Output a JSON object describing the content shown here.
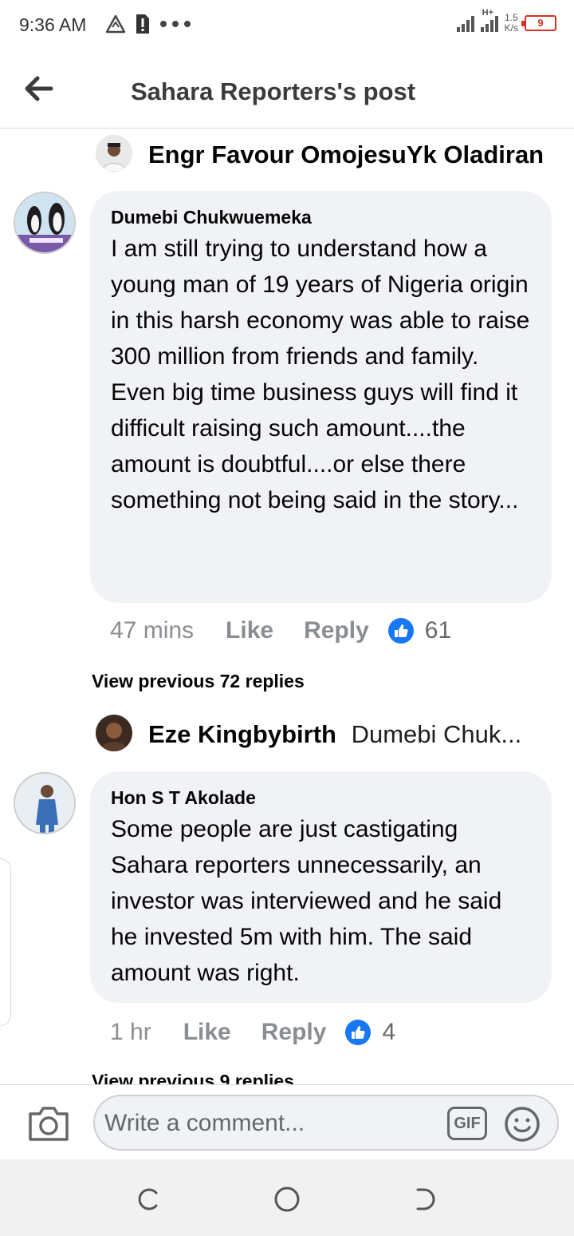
{
  "status_bar": {
    "time": "9:36 AM",
    "network_label": "H+",
    "net_speed_value": "1.5",
    "net_speed_unit": "K/s",
    "battery": "9"
  },
  "header": {
    "title": "Sahara Reporters's post"
  },
  "comments": [
    {
      "reply_preview": {
        "author": "Engr Favour OmojesuYk Oladiran",
        "snippet": ""
      },
      "author": "Dumebi Chukwuemeka",
      "text": "I am still trying to understand  how a young man of 19 years of Nigeria origin in this harsh economy was able to raise 300 million from friends and family. Even big time business guys will find it difficult raising such amount....the amount is doubtful....or else there something not being said in the story...",
      "time": "47 mins",
      "like_label": "Like",
      "reply_label": "Reply",
      "reactions": "61",
      "view_previous": "View previous 72 replies"
    },
    {
      "reply_preview": {
        "author": "Eze Kingbybirth",
        "snippet": "Dumebi Chuk..."
      },
      "author": "Hon S T Akolade",
      "text": "Some people are just castigating Sahara reporters unnecessarily, an investor was interviewed and he said he invested 5m with him. The said amount was right.",
      "time": "1 hr",
      "like_label": "Like",
      "reply_label": "Reply",
      "reactions": "4",
      "view_previous": "View previous 9 replies"
    }
  ],
  "composer": {
    "placeholder": "Write a comment...",
    "gif_label": "GIF"
  },
  "colors": {
    "accent": "#1877f2",
    "bubble": "#f0f2f5",
    "muted": "#8a8d91",
    "battery_low": "#d93025"
  },
  "icons": [
    "back-arrow-icon",
    "camera-icon",
    "gif-icon",
    "emoji-icon",
    "like-icon",
    "warning-icon",
    "sim-alert-icon",
    "more-dots-icon",
    "recents-icon",
    "home-icon",
    "back-nav-icon"
  ]
}
